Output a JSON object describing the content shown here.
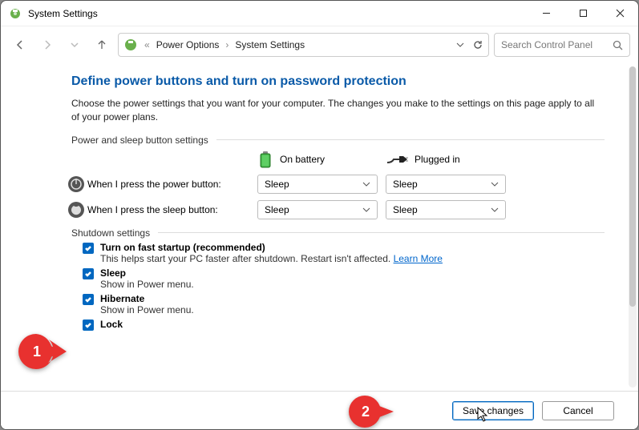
{
  "window": {
    "title": "System Settings"
  },
  "breadcrumb": {
    "part1": "Power Options",
    "part2": "System Settings"
  },
  "search": {
    "placeholder": "Search Control Panel"
  },
  "heading": "Define power buttons and turn on password protection",
  "subtext": "Choose the power settings that you want for your computer. The changes you make to the settings on this page apply to all of your power plans.",
  "section1": "Power and sleep button settings",
  "cols": {
    "battery": "On battery",
    "plugged": "Plugged in"
  },
  "rows": {
    "power": {
      "label": "When I press the power button:",
      "battery": "Sleep",
      "plugged": "Sleep"
    },
    "sleep": {
      "label": "When I press the sleep button:",
      "battery": "Sleep",
      "plugged": "Sleep"
    }
  },
  "section2": "Shutdown settings",
  "checks": {
    "fast": {
      "title": "Turn on fast startup (recommended)",
      "desc": "This helps start your PC faster after shutdown. Restart isn't affected. ",
      "link": "Learn More"
    },
    "sleep": {
      "title": "Sleep",
      "desc": "Show in Power menu."
    },
    "hibernate": {
      "title": "Hibernate",
      "desc": "Show in Power menu."
    },
    "lock": {
      "title": "Lock"
    }
  },
  "buttons": {
    "save": "Save changes",
    "cancel": "Cancel"
  },
  "callouts": {
    "one": "1",
    "two": "2"
  }
}
